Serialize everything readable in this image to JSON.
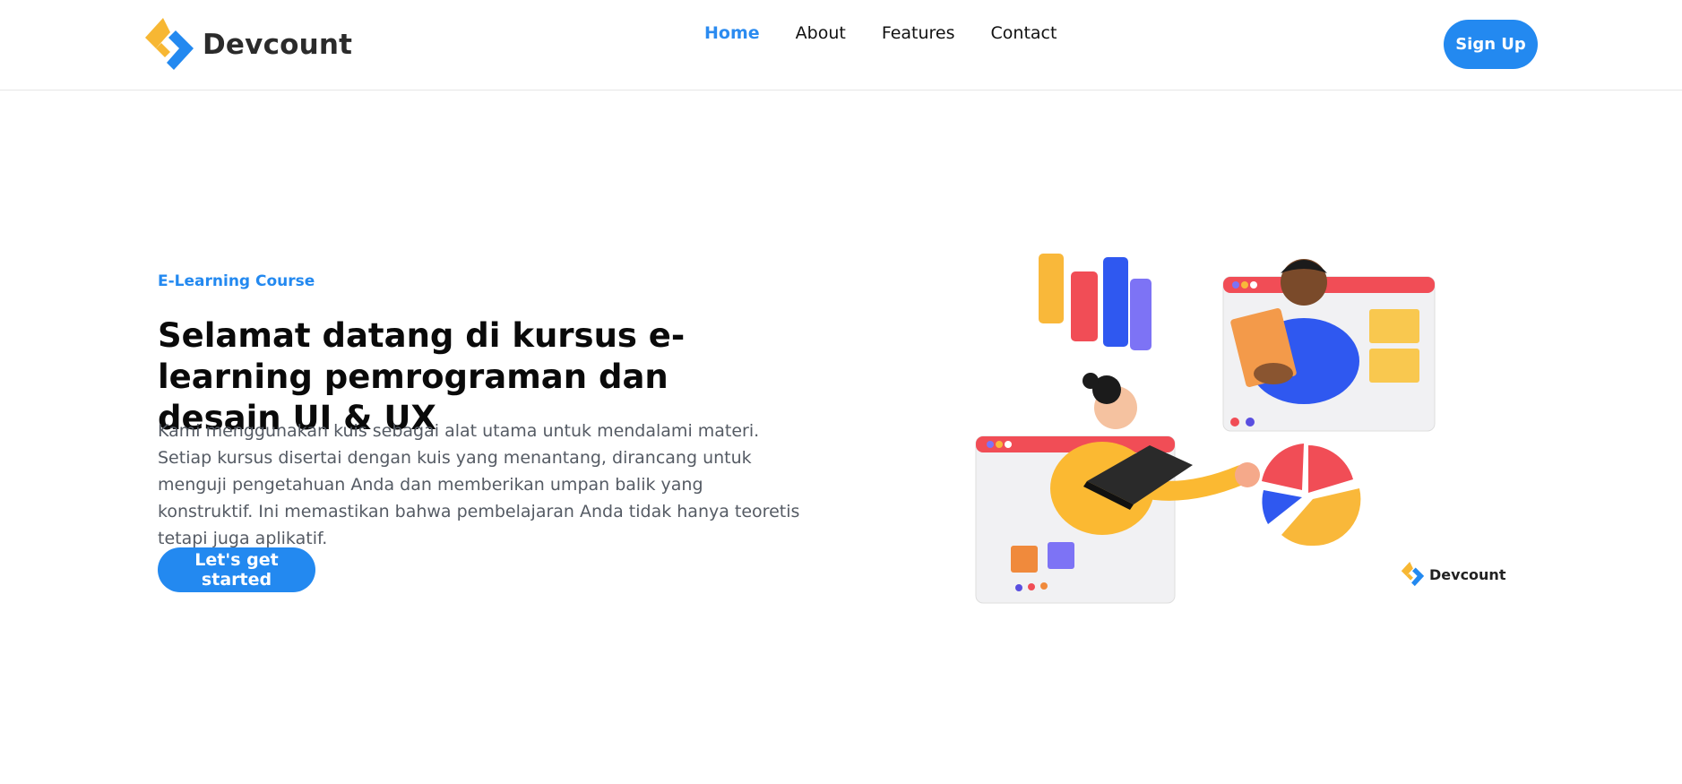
{
  "header": {
    "logo_text": "Devcount",
    "nav": [
      {
        "label": "Home",
        "active": true
      },
      {
        "label": "About",
        "active": false
      },
      {
        "label": "Features",
        "active": false
      },
      {
        "label": "Contact",
        "active": false
      }
    ],
    "signup_label": "Sign Up"
  },
  "hero": {
    "eyebrow": "E-Learning Course",
    "title": "Selamat datang di kursus e-learning pemrograman dan desain UI & UX",
    "description": "Kami menggunakan kuis sebagai alat utama untuk mendalami materi. Setiap kursus disertai dengan kuis yang menantang, dirancang untuk menguji pengetahuan Anda dan memberikan umpan balik yang konstruktif. Ini memastikan bahwa pembelajaran Anda tidak hanya teoretis tetapi juga aplikatif.",
    "cta_label": "Let's get started",
    "illustration_brand": "Devcount"
  },
  "colors": {
    "accent": "#2389f0",
    "logo_yellow": "#f7b733",
    "logo_blue": "#2389f0"
  },
  "icons": {
    "logo": "devcount-logo-icon"
  }
}
